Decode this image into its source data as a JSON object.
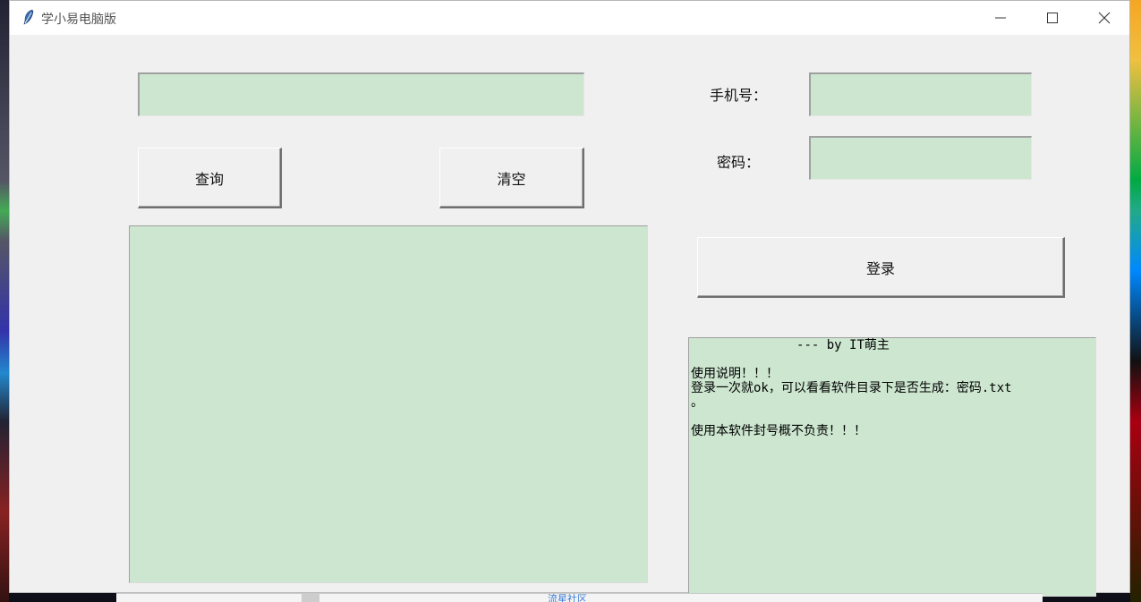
{
  "window": {
    "title": "学小易电脑版"
  },
  "colors": {
    "field_bg": "#cce6cf",
    "window_bg": "#f0f0f0"
  },
  "search": {
    "value": "",
    "query_button": "查询",
    "clear_button": "清空"
  },
  "login": {
    "phone_label": "手机号：",
    "phone_value": "",
    "password_label": "密码：",
    "password_value": "",
    "login_button": "登录"
  },
  "results": {
    "text": ""
  },
  "info": {
    "text": "              --- by IT萌主\n\n使用说明！！！\n登录一次就ok，可以看看软件目录下是否生成：密码.txt\n。\n\n使用本软件封号概不负责！！！"
  },
  "background": {
    "site_link": "流星社区"
  }
}
